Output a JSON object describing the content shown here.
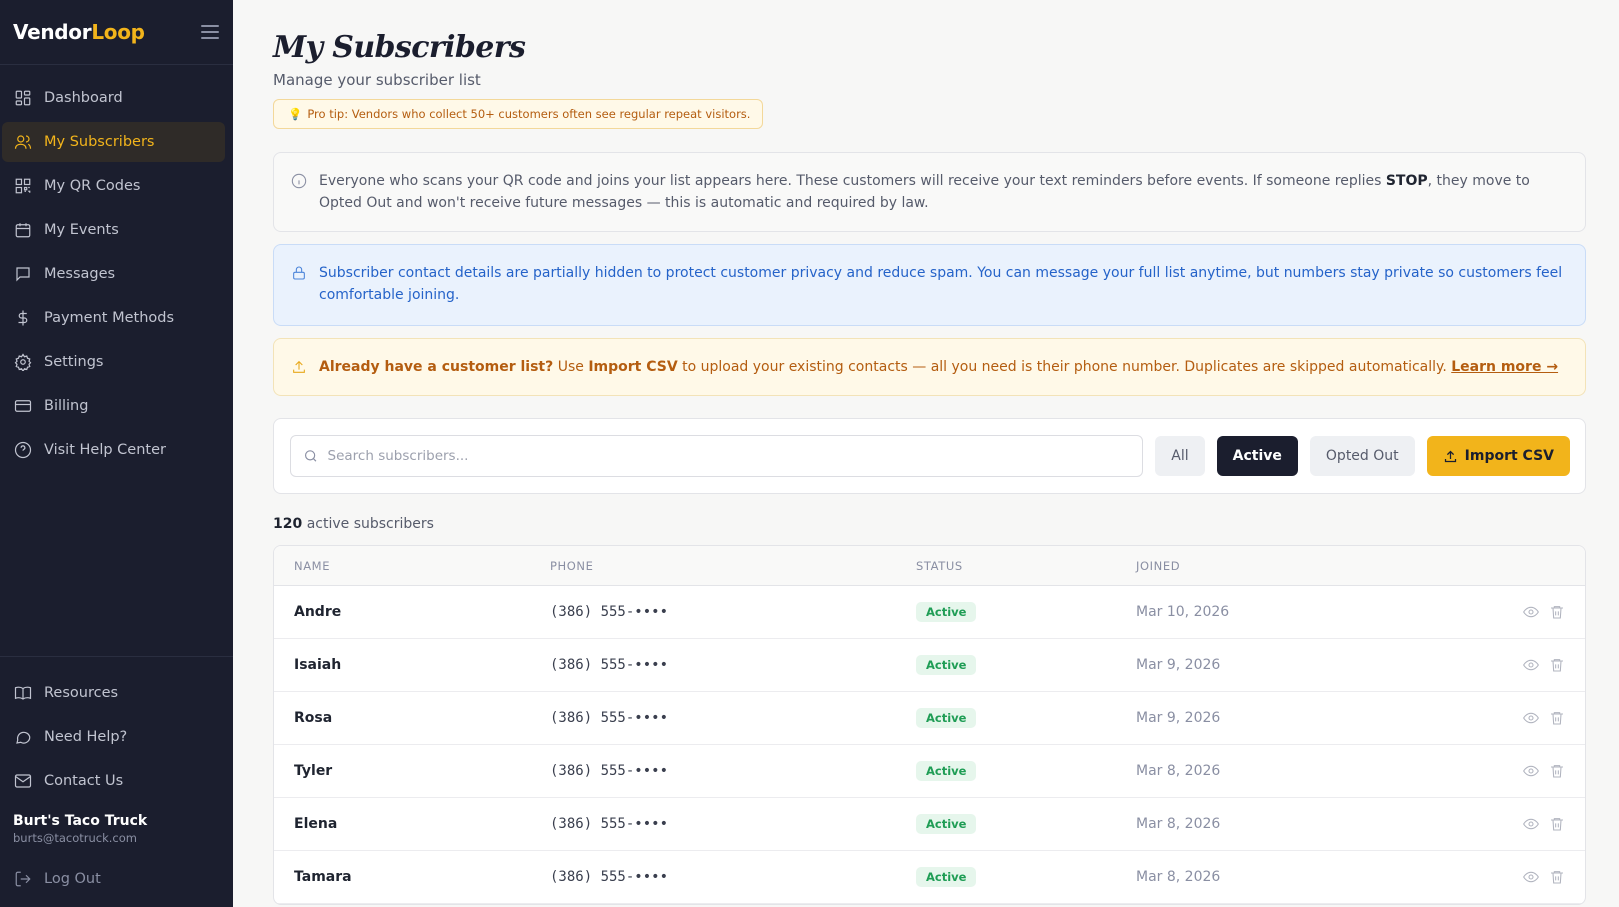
{
  "brand": {
    "name_main": "Vendor",
    "name_accent": "Loop"
  },
  "sidebar": {
    "items": [
      {
        "label": "Dashboard",
        "icon": "grid-icon"
      },
      {
        "label": "My Subscribers",
        "icon": "users-icon",
        "active": true
      },
      {
        "label": "My QR Codes",
        "icon": "qr-code-icon"
      },
      {
        "label": "My Events",
        "icon": "calendar-icon"
      },
      {
        "label": "Messages",
        "icon": "message-icon"
      },
      {
        "label": "Payment Methods",
        "icon": "dollar-icon"
      },
      {
        "label": "Settings",
        "icon": "gear-icon"
      },
      {
        "label": "Billing",
        "icon": "credit-card-icon"
      },
      {
        "label": "Visit Help Center",
        "icon": "help-circle-icon"
      }
    ],
    "bottom_items": [
      {
        "label": "Resources",
        "icon": "book-icon"
      },
      {
        "label": "Need Help?",
        "icon": "chat-icon"
      },
      {
        "label": "Contact Us",
        "icon": "mail-icon"
      }
    ],
    "account": {
      "name": "Burt's Taco Truck",
      "email": "burts@tacotruck.com"
    },
    "logout_label": "Log Out"
  },
  "header": {
    "title": "My Subscribers",
    "subtitle": "Manage your subscriber list",
    "pro_tip": "Pro tip: Vendors who collect 50+ customers often see regular repeat visitors."
  },
  "notices": {
    "info": {
      "before": "Everyone who scans your QR code and joins your list appears here. These customers will receive your text reminders before events. If someone replies ",
      "bold": "STOP",
      "after": ", they move to Opted Out and won't receive future messages — this is automatic and required by law."
    },
    "privacy": "Subscriber contact details are partially hidden to protect customer privacy and reduce spam. You can message your full list anytime, but numbers stay private so customers feel comfortable joining.",
    "import": {
      "bold_lead": "Already have a customer list?",
      "use": " Use ",
      "bold_action": "Import CSV",
      "rest": " to upload your existing contacts — all you need is their phone number. Duplicates are skipped automatically. ",
      "link": "Learn more →"
    }
  },
  "toolbar": {
    "search_placeholder": "Search subscribers...",
    "filters": [
      "All",
      "Active",
      "Opted Out"
    ],
    "active_filter": "Active",
    "import_label": "Import CSV"
  },
  "summary": {
    "count": "120",
    "label": "active subscribers"
  },
  "table": {
    "columns": [
      "NAME",
      "PHONE",
      "STATUS",
      "JOINED"
    ],
    "rows": [
      {
        "name": "Andre",
        "phone": "(386) 555-••••",
        "status": "Active",
        "joined": "Mar 10, 2026"
      },
      {
        "name": "Isaiah",
        "phone": "(386) 555-••••",
        "status": "Active",
        "joined": "Mar 9, 2026"
      },
      {
        "name": "Rosa",
        "phone": "(386) 555-••••",
        "status": "Active",
        "joined": "Mar 9, 2026"
      },
      {
        "name": "Tyler",
        "phone": "(386) 555-••••",
        "status": "Active",
        "joined": "Mar 8, 2026"
      },
      {
        "name": "Elena",
        "phone": "(386) 555-••••",
        "status": "Active",
        "joined": "Mar 8, 2026"
      },
      {
        "name": "Tamara",
        "phone": "(386) 555-••••",
        "status": "Active",
        "joined": "Mar 8, 2026"
      }
    ]
  },
  "colors": {
    "accent": "#f2b41b",
    "sidebar_bg": "#1b1e2e",
    "status_active": "#1f9d55",
    "privacy_blue": "#2563c9"
  }
}
